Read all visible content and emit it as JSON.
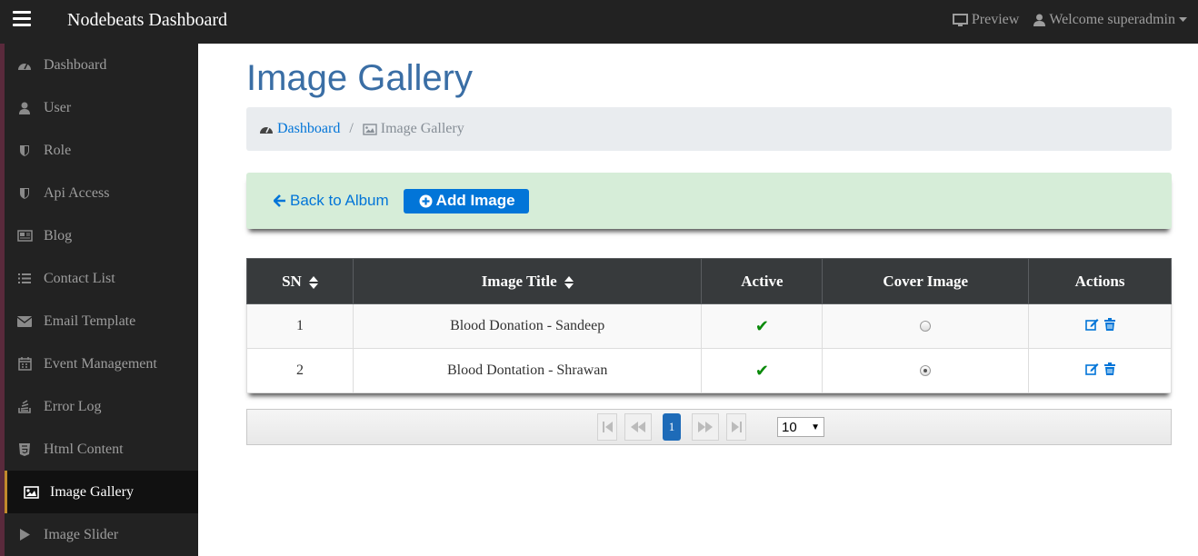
{
  "navbar": {
    "brand": "Nodebeats Dashboard",
    "preview_label": "Preview",
    "welcome_label": "Welcome superadmin"
  },
  "sidebar": {
    "items": [
      {
        "label": "Dashboard",
        "icon": "dashboard-icon"
      },
      {
        "label": "User",
        "icon": "user-icon"
      },
      {
        "label": "Role",
        "icon": "shield-icon"
      },
      {
        "label": "Api Access",
        "icon": "shield-icon"
      },
      {
        "label": "Blog",
        "icon": "newspaper-icon"
      },
      {
        "label": "Contact List",
        "icon": "list-icon"
      },
      {
        "label": "Email Template",
        "icon": "envelope-icon"
      },
      {
        "label": "Event Management",
        "icon": "calendar-icon"
      },
      {
        "label": "Error Log",
        "icon": "stack-icon"
      },
      {
        "label": "Html Content",
        "icon": "html5-icon"
      },
      {
        "label": "Image Gallery",
        "icon": "image-icon",
        "active": true
      },
      {
        "label": "Image Slider",
        "icon": "play-icon"
      }
    ]
  },
  "page": {
    "title": "Image Gallery"
  },
  "breadcrumb": {
    "home": "Dashboard",
    "separator": "/",
    "current": "Image Gallery"
  },
  "actions": {
    "back_label": "Back to Album",
    "add_label": "Add Image"
  },
  "table": {
    "headers": {
      "sn": "SN",
      "title": "Image Title",
      "active": "Active",
      "cover": "Cover Image",
      "actions": "Actions"
    },
    "rows": [
      {
        "sn": "1",
        "title": "Blood Donation - Sandeep",
        "active": true,
        "cover": false
      },
      {
        "sn": "2",
        "title": "Blood Dontation - Shrawan",
        "active": true,
        "cover": true
      }
    ]
  },
  "pager": {
    "current_page": "1",
    "page_size": "10"
  },
  "colors": {
    "navbar_bg": "#222222",
    "title_blue": "#3a6ea5",
    "link_blue": "#0275d8",
    "action_bar_bg": "#d6edd8",
    "table_header_bg": "#373a3c",
    "active_marker": "#c08a2b"
  }
}
